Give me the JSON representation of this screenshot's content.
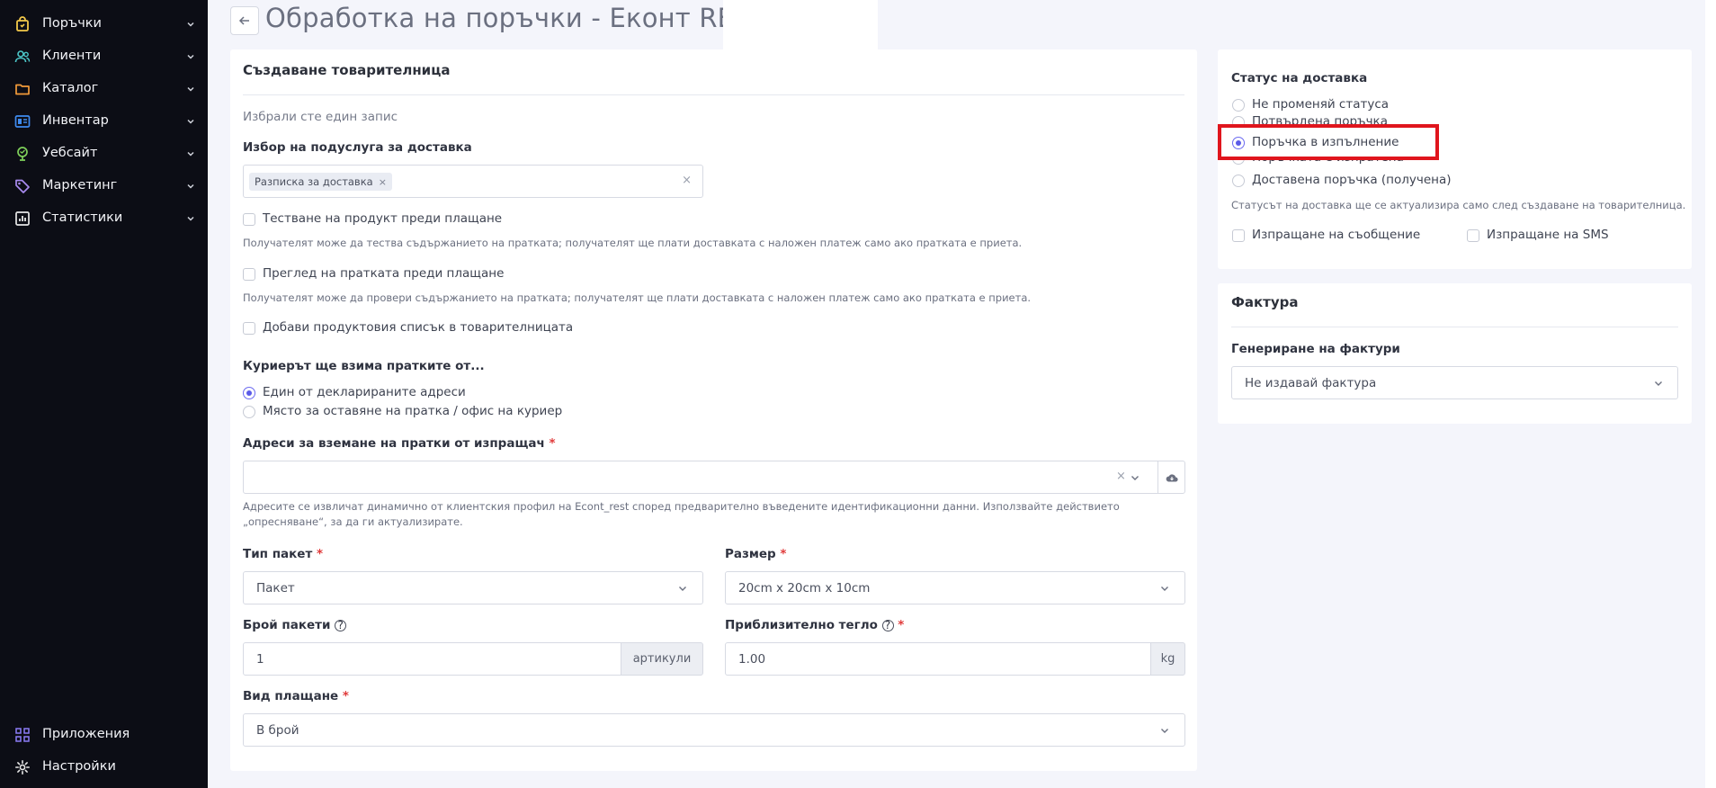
{
  "sidebar": {
    "items": [
      {
        "label": "Поръчки",
        "icon": "shopping-bag-icon",
        "color": "#f3c94a"
      },
      {
        "label": "Клиенти",
        "icon": "users-icon",
        "color": "#4cc7c9"
      },
      {
        "label": "Каталог",
        "icon": "folder-icon",
        "color": "#f39b3a"
      },
      {
        "label": "Инвентар",
        "icon": "inventory-icon",
        "color": "#3f8bef"
      },
      {
        "label": "Уебсайт",
        "icon": "globe-icon",
        "color": "#7fd05a"
      },
      {
        "label": "Маркетинг",
        "icon": "tag-icon",
        "color": "#a98bf0"
      },
      {
        "label": "Статистики",
        "icon": "chart-icon",
        "color": "#e8e8e8"
      }
    ],
    "bottom": [
      {
        "label": "Приложения",
        "icon": "apps-grid-icon",
        "color": "#8b7cf6"
      },
      {
        "label": "Настройки",
        "icon": "gear-icon",
        "color": "#e8e8e8"
      }
    ]
  },
  "header": {
    "title": "Обработка на поръчки - Еконт REST"
  },
  "shipment": {
    "title": "Създаване товарителница",
    "selected_note": "Избрали сте един запис",
    "service_label": "Избор на подуслуга за доставка",
    "service_tag": "Разписка за доставка",
    "options": [
      {
        "label": "Тестване на продукт преди плащане",
        "hint": "Получателят може да тества съдържанието на пратката; получателят ще плати доставката с наложен платеж само ако пратката е приета."
      },
      {
        "label": "Преглед на пратката преди плащане",
        "hint": "Получателят може да провери съдържанието на пратката; получателят ще плати доставката с наложен платеж само ако пратката е приета."
      },
      {
        "label": "Добави продуктовия списък в товарителницата",
        "hint": ""
      }
    ],
    "pickup_label": "Куриерът ще взима пратките от...",
    "pickup_options": [
      "Един от декларираните адреси",
      "Място за оставяне на пратка / офис на куриер"
    ],
    "pickup_selected": 0,
    "address_label": "Адреси за вземане на пратки от изпращач",
    "address_hint": "Адресите се извличат динамично от клиентския профил на Econt_rest според предварително въведените идентификационни данни. Използвайте действието „опресняване“, за да ги актуализирате.",
    "package_type_label": "Тип пакет",
    "package_type_value": "Пакет",
    "size_label": "Размер",
    "size_value": "20cm x 20cm x 10cm",
    "count_label": "Брой пакети",
    "count_value": "1",
    "count_unit": "артикули",
    "weight_label": "Приблизително тегло",
    "weight_value": "1.00",
    "weight_unit": "kg",
    "payment_label": "Вид плащане",
    "payment_value": "В брой",
    "required_mark": "*"
  },
  "delivery_status": {
    "title": "Статус на доставка",
    "options": [
      "Не променяй статуса",
      "Потвърдена поръчка",
      "Поръчка в изпълнение",
      "Поръчката е изпратена",
      "Доставена поръчка (получена)"
    ],
    "selected": 2,
    "hint": "Статусът на доставка ще се актуализира само след създаване на товарителница.",
    "send_message": "Изпращане на съобщение",
    "send_sms": "Изпращане на SMS"
  },
  "invoice": {
    "title": "Фактура",
    "label": "Генериране на фактури",
    "value": "Не издавай фактура"
  },
  "colors": {
    "sidebar_bg": "#0c0d15",
    "accent": "#5b5be8",
    "highlight": "#e0151d"
  }
}
